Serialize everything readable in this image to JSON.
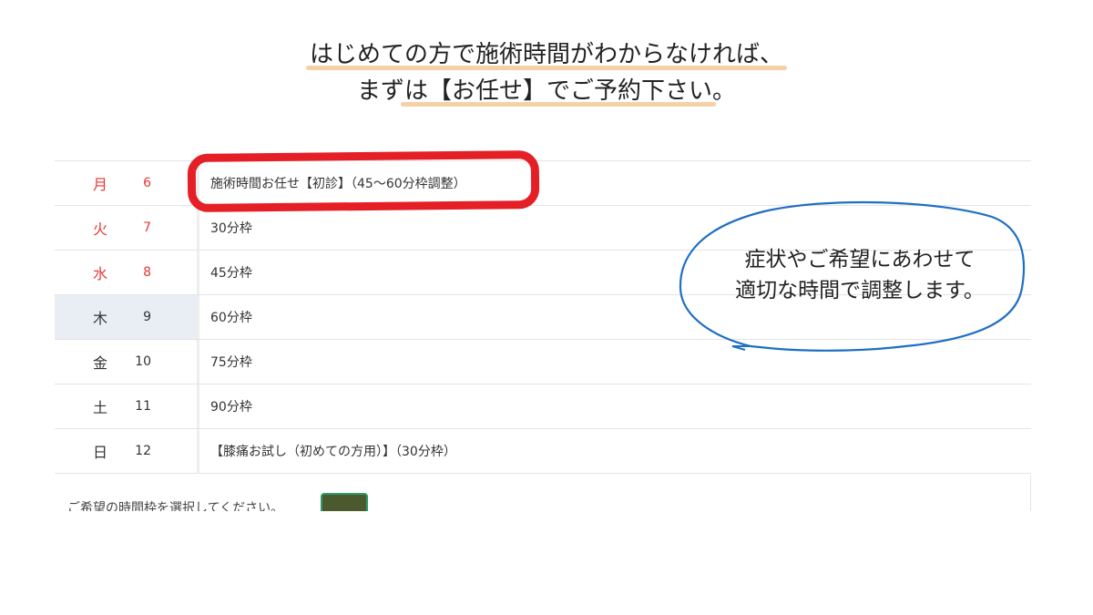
{
  "heading": {
    "line1": "はじめての方で施術時間がわからなければ、",
    "line2_pre": "まず",
    "line2_mid": "は【お任せ】でご予約下さい",
    "line2_post": "。",
    "highlight_color": "#f6d1a6"
  },
  "table": {
    "rows": [
      {
        "dow": "月",
        "date": "6",
        "slot": "施術時間お任せ【初診】（45〜60分枠調整）",
        "weekday_color": "#e53935"
      },
      {
        "dow": "火",
        "date": "7",
        "slot": "30分枠",
        "weekday_color": "#e53935"
      },
      {
        "dow": "水",
        "date": "8",
        "slot": "45分枠",
        "weekday_color": "#e53935"
      },
      {
        "dow": "木",
        "date": "9",
        "slot": "60分枠"
      },
      {
        "dow": "金",
        "date": "10",
        "slot": "75分枠"
      },
      {
        "dow": "土",
        "date": "11",
        "slot": "90分枠"
      },
      {
        "dow": "日",
        "date": "12",
        "slot": "【膝痛お試し（初めての方用）】（30分枠）"
      }
    ]
  },
  "bubble": {
    "line1": "症状やご希望にあわせて",
    "line2": "適切な時間で調整します。",
    "stroke_color": "#1f6fc4"
  },
  "annotation": {
    "ring_color": "#e51f26"
  },
  "footer": {
    "text": "ご希望の時間枠を選択してください。"
  }
}
